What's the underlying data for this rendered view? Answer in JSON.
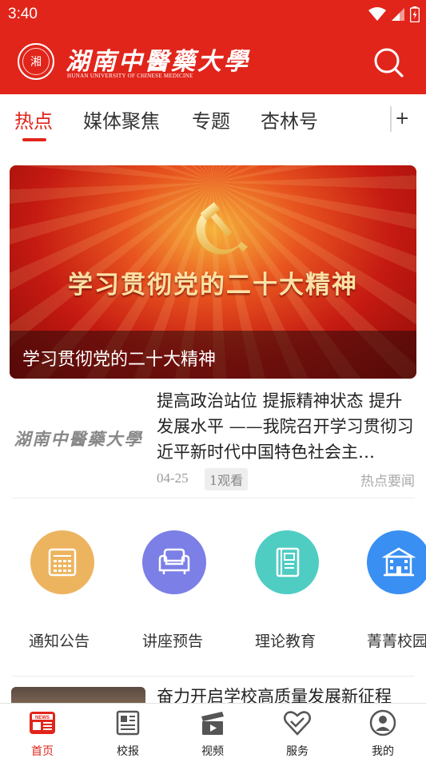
{
  "status_bar": {
    "time": "3:40"
  },
  "header": {
    "logo_seal_text": "湘",
    "logo_cn": "湖南中醫藥大學",
    "logo_en": "HUNAN UNIVERSITY OF CHINESE MEDICINE",
    "search_icon": "search-icon"
  },
  "tabs": {
    "items": [
      {
        "label": "热点",
        "active": true
      },
      {
        "label": "媒体聚焦",
        "active": false
      },
      {
        "label": "专题",
        "active": false
      },
      {
        "label": "杏林号",
        "active": false
      }
    ],
    "add_label": "+"
  },
  "banner": {
    "image_title": "学习贯彻党的二十大精神",
    "caption": "学习贯彻党的二十大精神"
  },
  "news_item": {
    "thumb_text": "湖南中醫藥大學",
    "title": "提高政治站位 提振精神状态 提升发展水平 ——我院召开学习贯彻习近平新时代中国特色社会主…",
    "date": "04-25",
    "views": "1观看",
    "category": "热点要闻"
  },
  "quick_links": [
    {
      "label": "通知公告",
      "icon": "calculator-icon",
      "color": "#edb45f"
    },
    {
      "label": "讲座预告",
      "icon": "sofa-icon",
      "color": "#7b7fe6"
    },
    {
      "label": "理论教育",
      "icon": "notebook-icon",
      "color": "#4fcdc3"
    },
    {
      "label": "菁菁校园",
      "icon": "building-icon",
      "color": "#3a8ff2"
    }
  ],
  "news_item_2": {
    "title": "奋力开启学校高质量发展新征程"
  },
  "bottom_nav": [
    {
      "label": "首页",
      "icon": "news-home-icon",
      "active": true
    },
    {
      "label": "校报",
      "icon": "newspaper-icon",
      "active": false
    },
    {
      "label": "视频",
      "icon": "video-icon",
      "active": false
    },
    {
      "label": "服务",
      "icon": "heart-service-icon",
      "active": false
    },
    {
      "label": "我的",
      "icon": "user-profile-icon",
      "active": false
    }
  ],
  "colors": {
    "brand_red": "#e1251b",
    "banner_text_gold": "#fbe1a4"
  }
}
